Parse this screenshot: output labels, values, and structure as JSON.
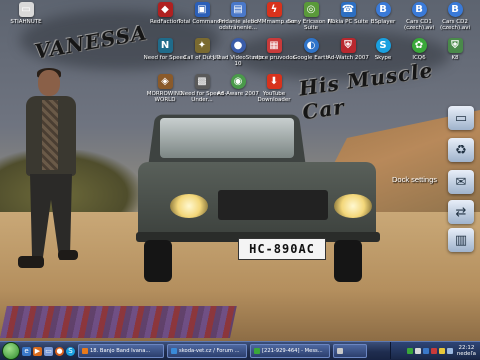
{
  "desktop": {
    "icons": [
      {
        "label": "STIAHNUTE",
        "icon": "folder-icon",
        "color": "#d9d9d9"
      },
      {
        "label": "RedFaction",
        "icon": "game-icon",
        "color": "#b02020"
      },
      {
        "label": "Total Commander",
        "icon": "floppy-icon",
        "color": "#2b5fb8"
      },
      {
        "label": "Pridanie alebo odstránenie...",
        "icon": "programs-icon",
        "color": "#4a78c9"
      },
      {
        "label": "IcMMmamp.exe",
        "icon": "lightning-icon",
        "color": "#d8321c"
      },
      {
        "label": "Sony Ericsson PC Suite",
        "icon": "phone-suite-icon",
        "color": "#5a9a3a"
      },
      {
        "label": "Nokia PC Suite",
        "icon": "nokia-icon",
        "color": "#2d6fc2"
      },
      {
        "label": "BSplayer",
        "icon": "bsplayer-icon",
        "color": "#3a7ad8"
      },
      {
        "label": "Cars CD1 (czech).avi",
        "icon": "bsplayer-icon",
        "color": "#3a7ad8"
      },
      {
        "label": "Cars CD2 (czech).avi",
        "icon": "bsplayer-icon",
        "color": "#3a7ad8"
      },
      {
        "label": "Need for Speed",
        "icon": "nfs-icon",
        "color": "#1f6b8a"
      },
      {
        "label": "Call of Duty 2",
        "icon": "cod-icon",
        "color": "#7a6a30"
      },
      {
        "label": "Ulead VideoStudio 10",
        "icon": "ulead-icon",
        "color": "#3a5ca8"
      },
      {
        "label": "rapce pruvodos",
        "icon": "utility-icon",
        "color": "#c83a3a"
      },
      {
        "label": "Google Earth",
        "icon": "globe-icon",
        "color": "#2f74c9"
      },
      {
        "label": "Ad-Watch 2007",
        "icon": "shield-icon",
        "color": "#b8282e"
      },
      {
        "label": "Skype",
        "icon": "skype-icon",
        "color": "#1aa0e0"
      },
      {
        "label": "ICQ6",
        "icon": "flower-icon",
        "color": "#3aa83a"
      },
      {
        "label": "K8",
        "icon": "shield-small-icon",
        "color": "#4a8a4a"
      },
      {
        "label": "MORROWIND WORLD",
        "icon": "morrowind-icon",
        "color": "#8a5a2a"
      },
      {
        "label": "Need for Speed Under...",
        "icon": "nfs-underground-icon",
        "color": "#5a5a5a"
      },
      {
        "label": "Ad-Aware 2007",
        "icon": "adaware-icon",
        "color": "#4a9a4a"
      },
      {
        "label": "YouTube Downloader",
        "icon": "download-icon",
        "color": "#d8321c"
      }
    ],
    "graffiti": [
      "VANESSA",
      "His Muscle Car"
    ],
    "license_plate": "HC-890AC",
    "dock": {
      "label": "Dock settings",
      "items": [
        "monitor-icon",
        "recycle-bin-icon",
        "mail-icon",
        "network-icon",
        "drive-icon"
      ]
    }
  },
  "taskbar": {
    "tasks": [
      {
        "label": "18. Banjo Band Ivana...",
        "color": "#e87a1c"
      },
      {
        "label": "skoda-vet.cz / Forum ...",
        "color": "#3a8ad8"
      },
      {
        "label": "[221-929-464] - Mess...",
        "color": "#3aa83a"
      },
      {
        "label": "",
        "color": "#c8c8c8"
      }
    ],
    "clock_time": "22:12",
    "clock_day": "nedeľa"
  }
}
